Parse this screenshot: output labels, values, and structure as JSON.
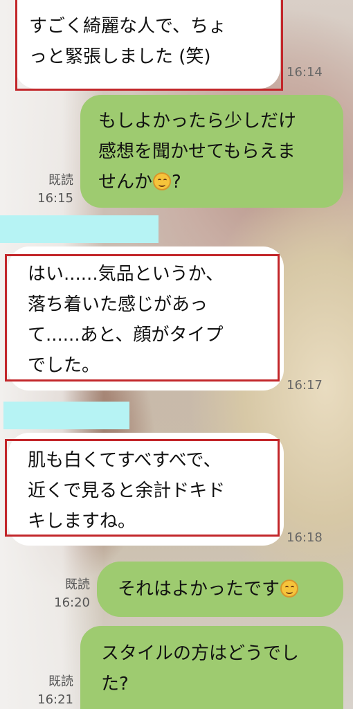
{
  "messages": [
    {
      "text": "すごく綺麗な人で、ちょ\nっと緊張しました (笑)",
      "time": "16:14"
    },
    {
      "text_before": "もしよかったら少しだけ\n感想を聞かせてもらえま\nせんか",
      "emoji": "smiling-face",
      "text_after": "?",
      "read": "既読",
      "time": "16:15"
    },
    {
      "text": "はい......気品というか、\n落ち着いた感じがあっ\nて......あと、顔がタイプ\nでした。",
      "time": "16:17"
    },
    {
      "text": "肌も白くてすべすべで、\n近くで見ると余計ドキド\nキしますね。",
      "time": "16:18"
    },
    {
      "text_before": "それはよかったです",
      "emoji": "smiling-face",
      "read": "既読",
      "time": "16:20"
    },
    {
      "text": "スタイルの方はどうでし\nた?",
      "read": "既読",
      "time": "16:21"
    }
  ],
  "colors": {
    "outgoing_bubble": "#9ecb70",
    "incoming_bubble": "#ffffff",
    "highlight_box": "#c2262a",
    "redaction": "#b6f3f4"
  }
}
